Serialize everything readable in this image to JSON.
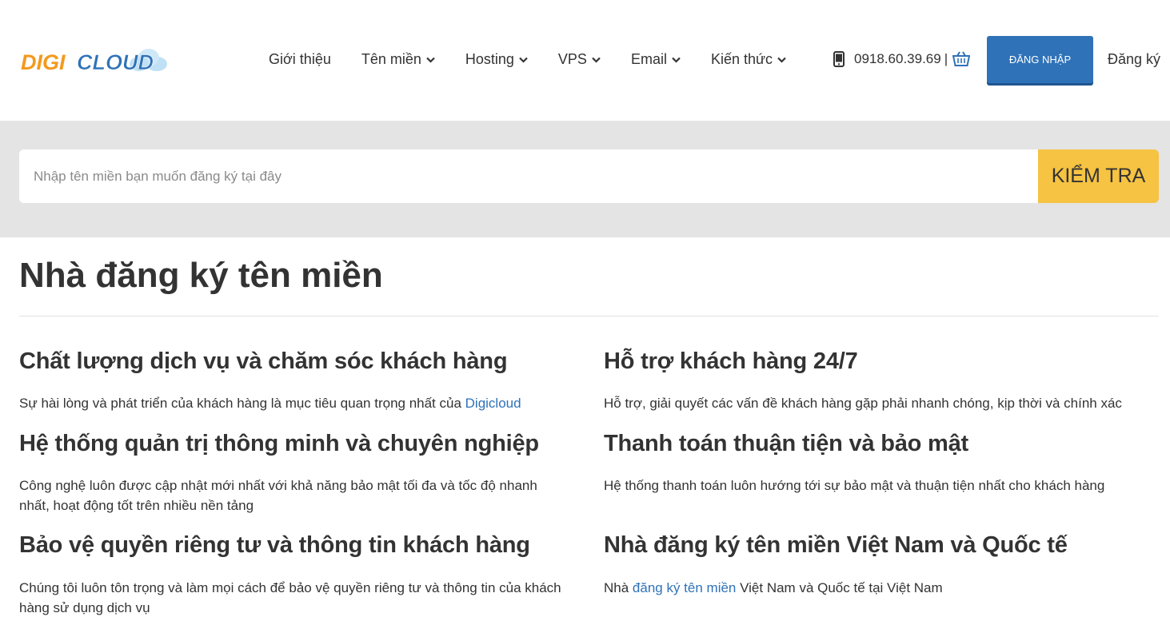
{
  "header": {
    "logo": {
      "part1": "DIGI",
      "part2": "CLOUD"
    },
    "nav": [
      {
        "label": "Giới thiệu",
        "dropdown": false
      },
      {
        "label": "Tên miền",
        "dropdown": true
      },
      {
        "label": "Hosting",
        "dropdown": true
      },
      {
        "label": "VPS",
        "dropdown": true
      },
      {
        "label": "Email",
        "dropdown": true
      },
      {
        "label": "Kiến thức",
        "dropdown": true
      }
    ],
    "phone": "0918.60.39.69",
    "separator": "|",
    "login_label": "ĐĂNG NHẬP",
    "register_label": "Đăng ký"
  },
  "search": {
    "placeholder": "Nhập tên miền bạn muốn đăng ký tại đây",
    "button_label": "KIỂM TRA"
  },
  "main": {
    "title": "Nhà đăng ký tên miền",
    "features": [
      {
        "title": "Chất lượng dịch vụ và chăm sóc khách hàng",
        "desc_before": "Sự hài lòng và phát triển của khách hàng là mục tiêu quan trọng nhất của ",
        "link": "Digicloud",
        "desc_after": ""
      },
      {
        "title": "Hỗ trợ khách hàng 24/7",
        "desc_before": "Hỗ trợ, giải quyết các vấn đề khách hàng gặp phải nhanh chóng, kịp thời và chính xác",
        "link": "",
        "desc_after": ""
      },
      {
        "title": "Hệ thống quản trị thông minh và chuyên nghiệp",
        "desc_before": "Công nghệ luôn được cập nhật mới nhất với khả năng bảo mật tối đa và tốc độ nhanh nhất, hoạt động tốt trên nhiều nền tảng",
        "link": "",
        "desc_after": ""
      },
      {
        "title": "Thanh toán thuận tiện và bảo mật",
        "desc_before": "Hệ thống thanh toán luôn hướng tới sự bảo mật và thuận tiện nhất cho khách hàng",
        "link": "",
        "desc_after": ""
      },
      {
        "title": "Bảo vệ quyền riêng tư và thông tin khách hàng",
        "desc_before": "Chúng tôi luôn tôn trọng và làm mọi cách để bảo vệ quyền riêng tư và thông tin của khách hàng sử dụng dịch vụ",
        "link": "",
        "desc_after": ""
      },
      {
        "title": "Nhà đăng ký tên miền Việt Nam và Quốc tế",
        "desc_before": "Nhà ",
        "link": "đăng ký tên miền",
        "desc_after": " Việt Nam và Quốc tế tại Việt Nam"
      }
    ]
  },
  "colors": {
    "brand_orange": "#f39a1e",
    "brand_blue": "#2f72b8",
    "search_button": "#f6c342",
    "band_gray": "#e4e4e4"
  },
  "icons": [
    "chevron-down-icon",
    "phone-icon",
    "cart-icon",
    "cloud-icon"
  ]
}
